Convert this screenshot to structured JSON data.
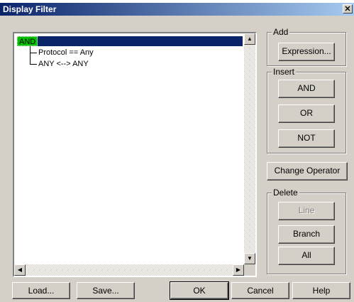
{
  "window": {
    "title": "Display Filter"
  },
  "tree": {
    "root": "AND",
    "children": [
      "Protocol == Any",
      "ANY <--> ANY"
    ]
  },
  "groups": {
    "add": {
      "label": "Add",
      "buttons": [
        "Expression..."
      ]
    },
    "insert": {
      "label": "Insert",
      "buttons": [
        "AND",
        "OR",
        "NOT"
      ]
    },
    "change_operator": "Change Operator",
    "delete": {
      "label": "Delete",
      "buttons": [
        "Line",
        "Branch",
        "All"
      ]
    }
  },
  "footer": {
    "load": "Load...",
    "save": "Save...",
    "ok": "OK",
    "cancel": "Cancel",
    "help": "Help"
  },
  "icons": {
    "close": "close-icon",
    "scroll_up": "arrow-up-icon",
    "scroll_down": "arrow-down-icon",
    "scroll_left": "arrow-left-icon",
    "scroll_right": "arrow-right-icon"
  },
  "colors": {
    "selection": "#0a246a",
    "root_node": "#00c000",
    "dialog": "#d4d0c8"
  }
}
